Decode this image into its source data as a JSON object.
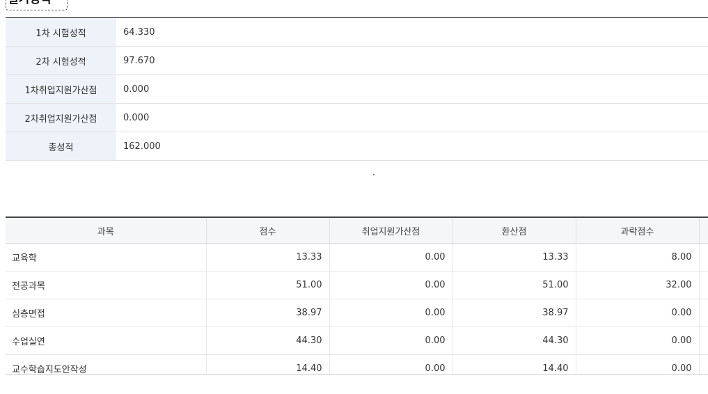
{
  "section": {
    "title": "필기성적"
  },
  "summary": [
    {
      "label": "1차 시험성적",
      "value": "64.330"
    },
    {
      "label": "2차 시험성적",
      "value": "97.670"
    },
    {
      "label": "1차취업지원가산점",
      "value": "0.000"
    },
    {
      "label": "2차취업지원가산점",
      "value": "0.000"
    },
    {
      "label": "총성적",
      "value": "162.000"
    }
  ],
  "scores": {
    "headers": [
      "과목",
      "점수",
      "취업지원가산점",
      "환산점",
      "과락점수"
    ],
    "rows": [
      [
        "교육학",
        "13.33",
        "0.00",
        "13.33",
        "8.00"
      ],
      [
        "전공과목",
        "51.00",
        "0.00",
        "51.00",
        "32.00"
      ],
      [
        "심층면접",
        "38.97",
        "0.00",
        "38.97",
        "0.00"
      ],
      [
        "수업실연",
        "44.30",
        "0.00",
        "44.30",
        "0.00"
      ],
      [
        "교수학습지도안작성",
        "14.40",
        "0.00",
        "14.40",
        "0.00"
      ]
    ]
  }
}
